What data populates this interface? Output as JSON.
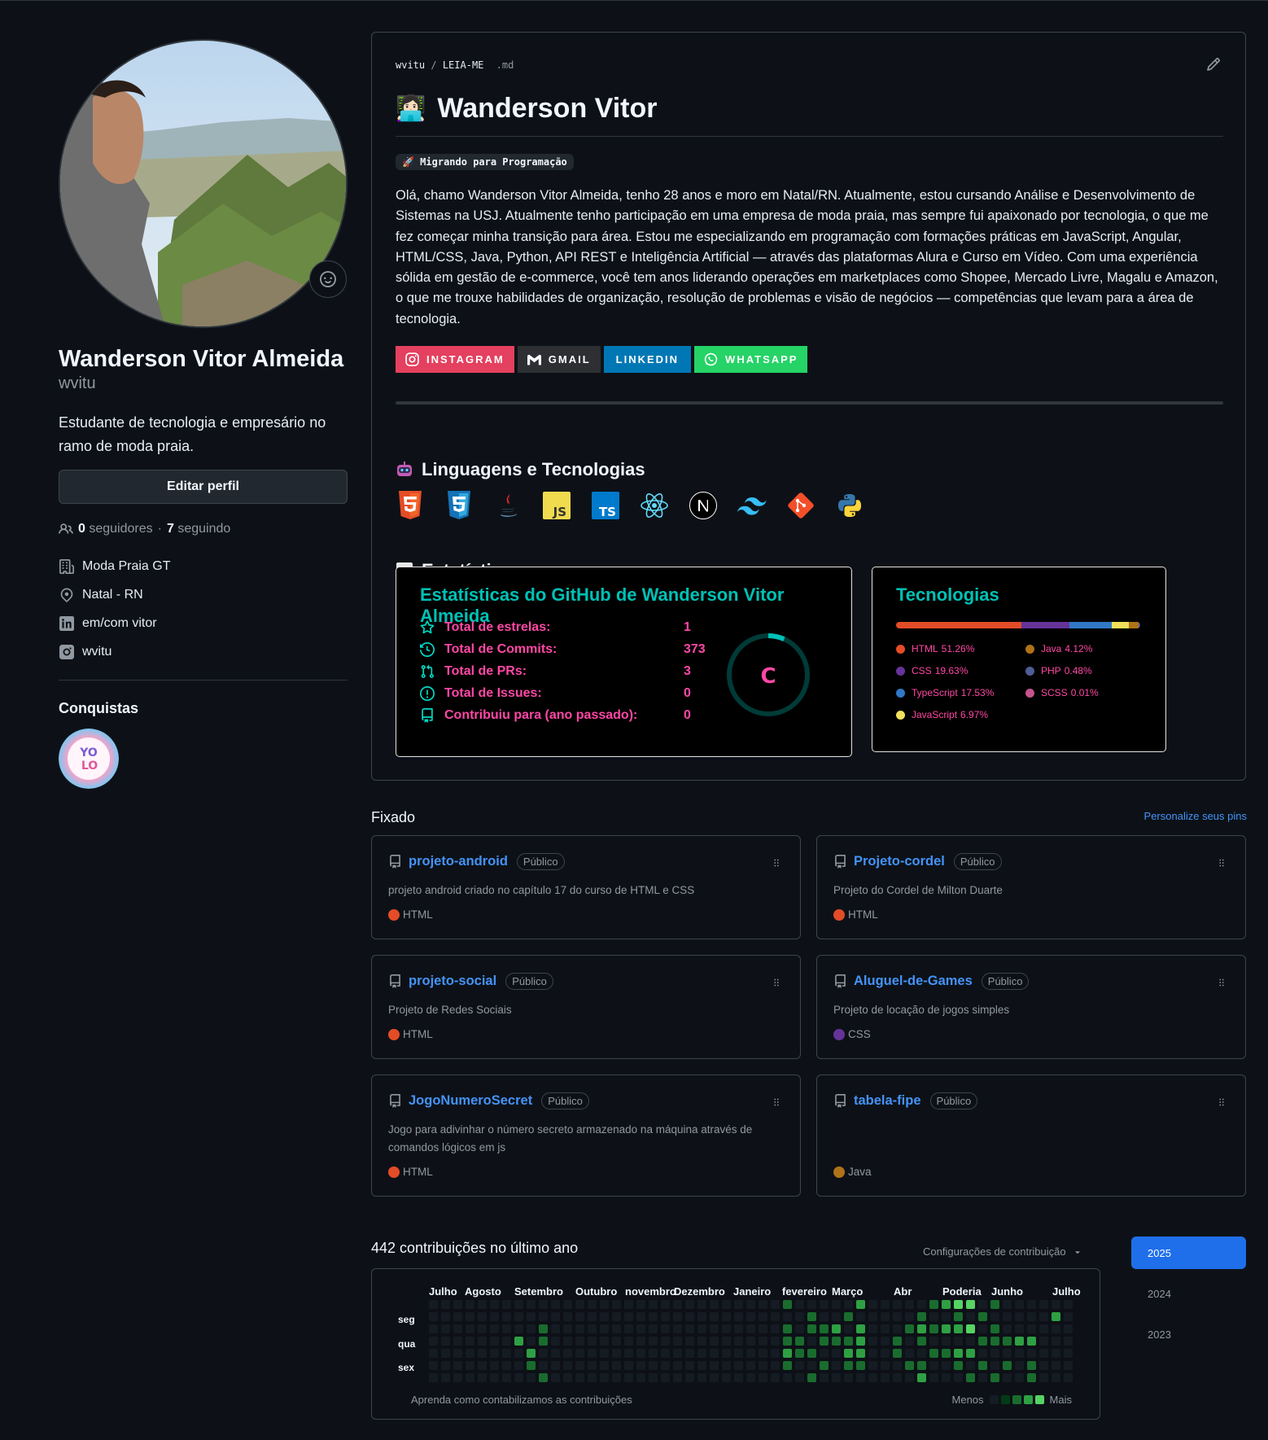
{
  "profile": {
    "full_name": "Wanderson Vitor Almeida",
    "username": "wvitu",
    "bio": "Estudante de tecnologia e empresário no ramo de moda praia.",
    "edit_label": "Editar perfil",
    "followers_count": "0",
    "followers_label": "seguidores",
    "separator": "·",
    "following_count": "7",
    "following_label": "seguindo",
    "details": [
      {
        "icon": "organization-icon",
        "text": "Moda Praia GT"
      },
      {
        "icon": "location-icon",
        "text": "Natal - RN"
      },
      {
        "icon": "linkedin-icon",
        "text": "em/com vitor"
      },
      {
        "icon": "instagram-icon",
        "text": "wvitu"
      }
    ],
    "achievements_title": "Conquistas",
    "achievement": "YOLO"
  },
  "readme": {
    "path_user": "wvitu",
    "path_sep": "/",
    "path_repo": "LEIA-ME",
    "path_ext": ".md",
    "title_emoji": "👩🏻‍💻",
    "title": "Wanderson Vitor",
    "tag": "🚀 Migrando para Programação",
    "paragraph": "Olá, chamo Wanderson Vitor Almeida, tenho 28 anos e moro em Natal/RN. Atualmente, estou cursando Análise e Desenvolvimento de Sistemas na USJ. Atualmente tenho participação em uma empresa de moda praia, mas sempre fui apaixonado por tecnologia, o que me fez começar minha transição para área. Estou me especializando em programação com formações práticas em JavaScript, Angular, HTML/CSS, Java, Python, API REST e Inteligência Artificial — através das plataformas Alura e Curso em Vídeo. Com uma experiência sólida em gestão de e-commerce, você tem anos liderando operações em marketplaces como Shopee, Mercado Livre, Magalu e Amazon, o que me trouxe habilidades de organização, resolução de problemas e visão de negócios — competências que levam para a área de tecnologia.",
    "social": [
      {
        "label": "INSTAGRAM",
        "icon": "instagram-icon",
        "color": "#e4405f"
      },
      {
        "label": "GMAIL",
        "icon": "gmail-icon",
        "color": "#2d2f33"
      },
      {
        "label": "LINKEDIN",
        "icon": "",
        "color": "#0077b5"
      },
      {
        "label": "WHATSAPP",
        "icon": "whatsapp-icon",
        "color": "#25d366"
      }
    ],
    "tech_heading": "Linguagens e Tecnologias",
    "tech_icons": [
      "html5-icon",
      "css3-icon",
      "java-icon",
      "javascript-icon",
      "typescript-icon",
      "react-icon",
      "nextjs-icon",
      "tailwind-icon",
      "git-icon",
      "python-icon"
    ],
    "stats_heading": "Estatísticas",
    "stats": {
      "title": "Estatísticas do GitHub de Wanderson Vitor Almeida",
      "rank": "C",
      "rows": [
        {
          "icon": "star-icon",
          "label": "Total de estrelas:",
          "value": "1"
        },
        {
          "icon": "history-icon",
          "label": "Total de Commits:",
          "value": "373"
        },
        {
          "icon": "pull-request-icon",
          "label": "Total de PRs:",
          "value": "3"
        },
        {
          "icon": "issue-icon",
          "label": "Total de Issues:",
          "value": "0"
        },
        {
          "icon": "repo-icon",
          "label": "Contribuiu para (ano passado):",
          "value": "0"
        }
      ]
    },
    "languages": {
      "title": "Tecnologias",
      "items": [
        {
          "name": "HTML",
          "pct": "51.26%",
          "value": 51.26,
          "color": "#e34c26"
        },
        {
          "name": "CSS",
          "pct": "19.63%",
          "value": 19.63,
          "color": "#663399"
        },
        {
          "name": "TypeScript",
          "pct": "17.53%",
          "value": 17.53,
          "color": "#3178c6"
        },
        {
          "name": "JavaScript",
          "pct": "6.97%",
          "value": 6.97,
          "color": "#f1e05a"
        },
        {
          "name": "Java",
          "pct": "4.12%",
          "value": 4.12,
          "color": "#b07219"
        },
        {
          "name": "PHP",
          "pct": "0.48%",
          "value": 0.48,
          "color": "#4f5d95"
        },
        {
          "name": "SCSS",
          "pct": "0.01%",
          "value": 0.01,
          "color": "#c6538c"
        }
      ]
    }
  },
  "pinned": {
    "title": "Fixado",
    "customize": "Personalize seus pins",
    "repos": [
      {
        "name": "projeto-android",
        "visibility": "Público",
        "description": "projeto android criado no capítulo 17 do curso de HTML e CSS",
        "language": "HTML",
        "lang_color": "#e34c26"
      },
      {
        "name": "Projeto-cordel",
        "visibility": "Público",
        "description": "Projeto do Cordel de Milton Duarte",
        "language": "HTML",
        "lang_color": "#e34c26"
      },
      {
        "name": "projeto-social",
        "visibility": "Público",
        "description": "Projeto de Redes Sociais",
        "language": "HTML",
        "lang_color": "#e34c26"
      },
      {
        "name": "Aluguel-de-Games",
        "visibility": "Público",
        "description": "Projeto de locação de jogos simples",
        "language": "CSS",
        "lang_color": "#663399"
      },
      {
        "name": "JogoNumeroSecret",
        "visibility": "Público",
        "description": "Jogo para adivinhar o número secreto armazenado na máquina através de comandos lógicos em js",
        "language": "HTML",
        "lang_color": "#e34c26"
      },
      {
        "name": "tabela-fipe",
        "visibility": "Público",
        "description": "",
        "language": "Java",
        "lang_color": "#b07219"
      }
    ]
  },
  "contributions": {
    "heading": "442 contribuições no último ano",
    "settings": "Configurações de contribuição",
    "months": [
      "Julho",
      "Agosto",
      "Setembro",
      "Outubro",
      "novembro",
      "Dezembro",
      "Janeiro",
      "fevereiro",
      "Março",
      "Abr",
      "Poderia",
      "Junho",
      "Julho"
    ],
    "days": [
      "seg",
      "qua",
      "sex"
    ],
    "learn": "Aprenda como contabilizamos as contribuições",
    "less": "Menos",
    "more": "Mais",
    "level_colors": [
      "#151b23",
      "#033a16",
      "#196c2e",
      "#2ea043",
      "#56d364"
    ],
    "years": [
      "2025",
      "2024",
      "2023"
    ],
    "active_year": "2025"
  }
}
